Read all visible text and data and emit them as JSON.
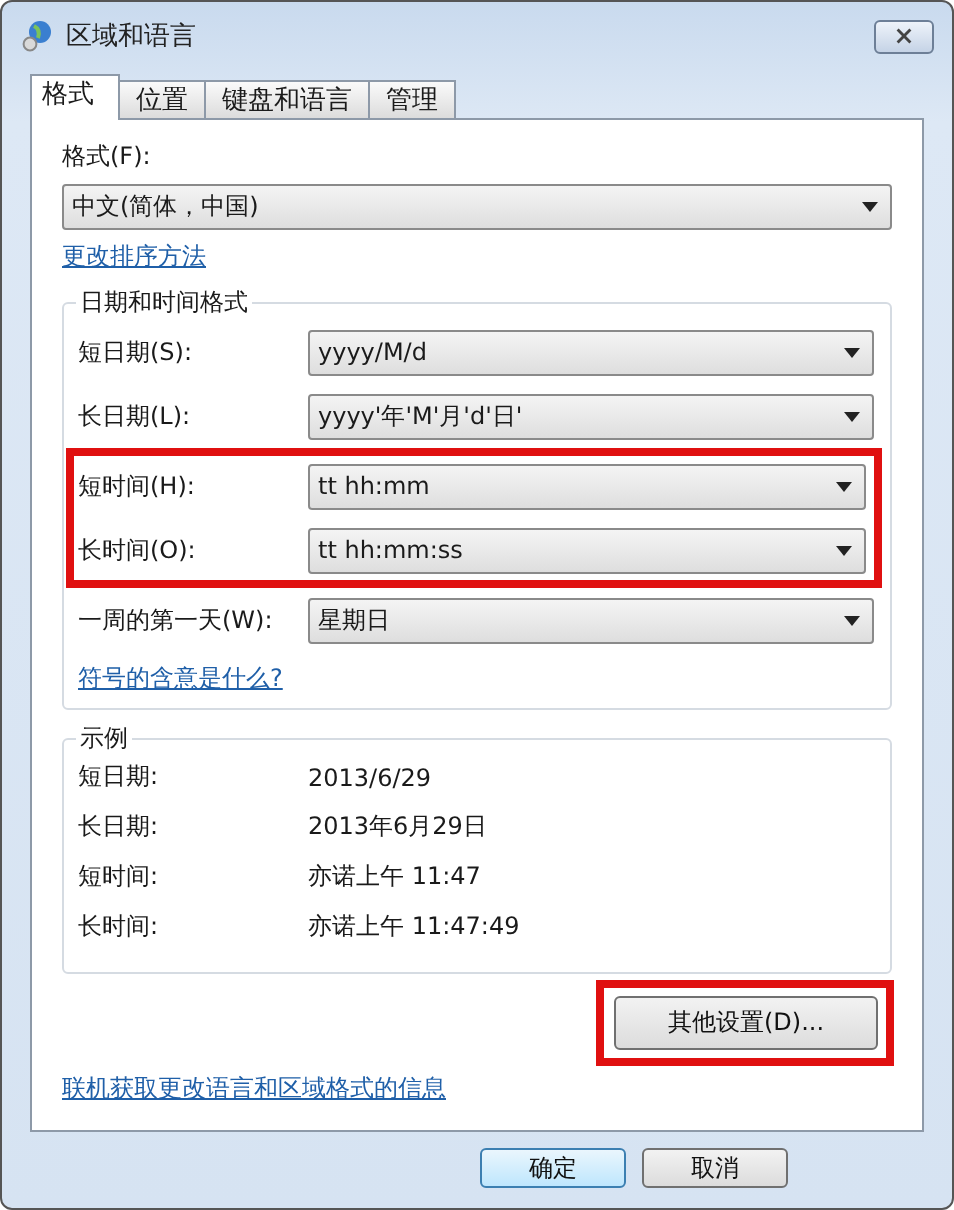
{
  "window": {
    "title": "区域和语言"
  },
  "tabs": [
    {
      "label": "格式",
      "selected": true
    },
    {
      "label": "位置",
      "selected": false
    },
    {
      "label": "键盘和语言",
      "selected": false
    },
    {
      "label": "管理",
      "selected": false
    }
  ],
  "format": {
    "label": "格式(F):",
    "value": "中文(简体，中国)"
  },
  "sort_link": "更改排序方法",
  "date_time_formats": {
    "title": "日期和时间格式",
    "rows": [
      {
        "label": "短日期(S):",
        "value": "yyyy/M/d",
        "highlighted": false
      },
      {
        "label": "长日期(L):",
        "value": "yyyy'年'M'月'd'日'",
        "highlighted": false
      },
      {
        "label": "短时间(H):",
        "value": "tt hh:mm",
        "highlighted": true
      },
      {
        "label": "长时间(O):",
        "value": "tt hh:mm:ss",
        "highlighted": true
      },
      {
        "label": "一周的第一天(W):",
        "value": "星期日",
        "highlighted": false
      }
    ],
    "link": "符号的含意是什么?"
  },
  "examples": {
    "title": "示例",
    "rows": [
      {
        "label": "短日期:",
        "value": "2013/6/29"
      },
      {
        "label": "长日期:",
        "value": "2013年6月29日"
      },
      {
        "label": "短时间:",
        "value": "亦诺上午 11:47"
      },
      {
        "label": "长时间:",
        "value": "亦诺上午 11:47:49"
      }
    ]
  },
  "other_settings_button": {
    "label": "其他设置(D)...",
    "highlighted": true
  },
  "online_link": "联机获取更改语言和区域格式的信息",
  "buttons": [
    {
      "label": "确定",
      "default": true
    },
    {
      "label": "取消",
      "default": false
    }
  ]
}
